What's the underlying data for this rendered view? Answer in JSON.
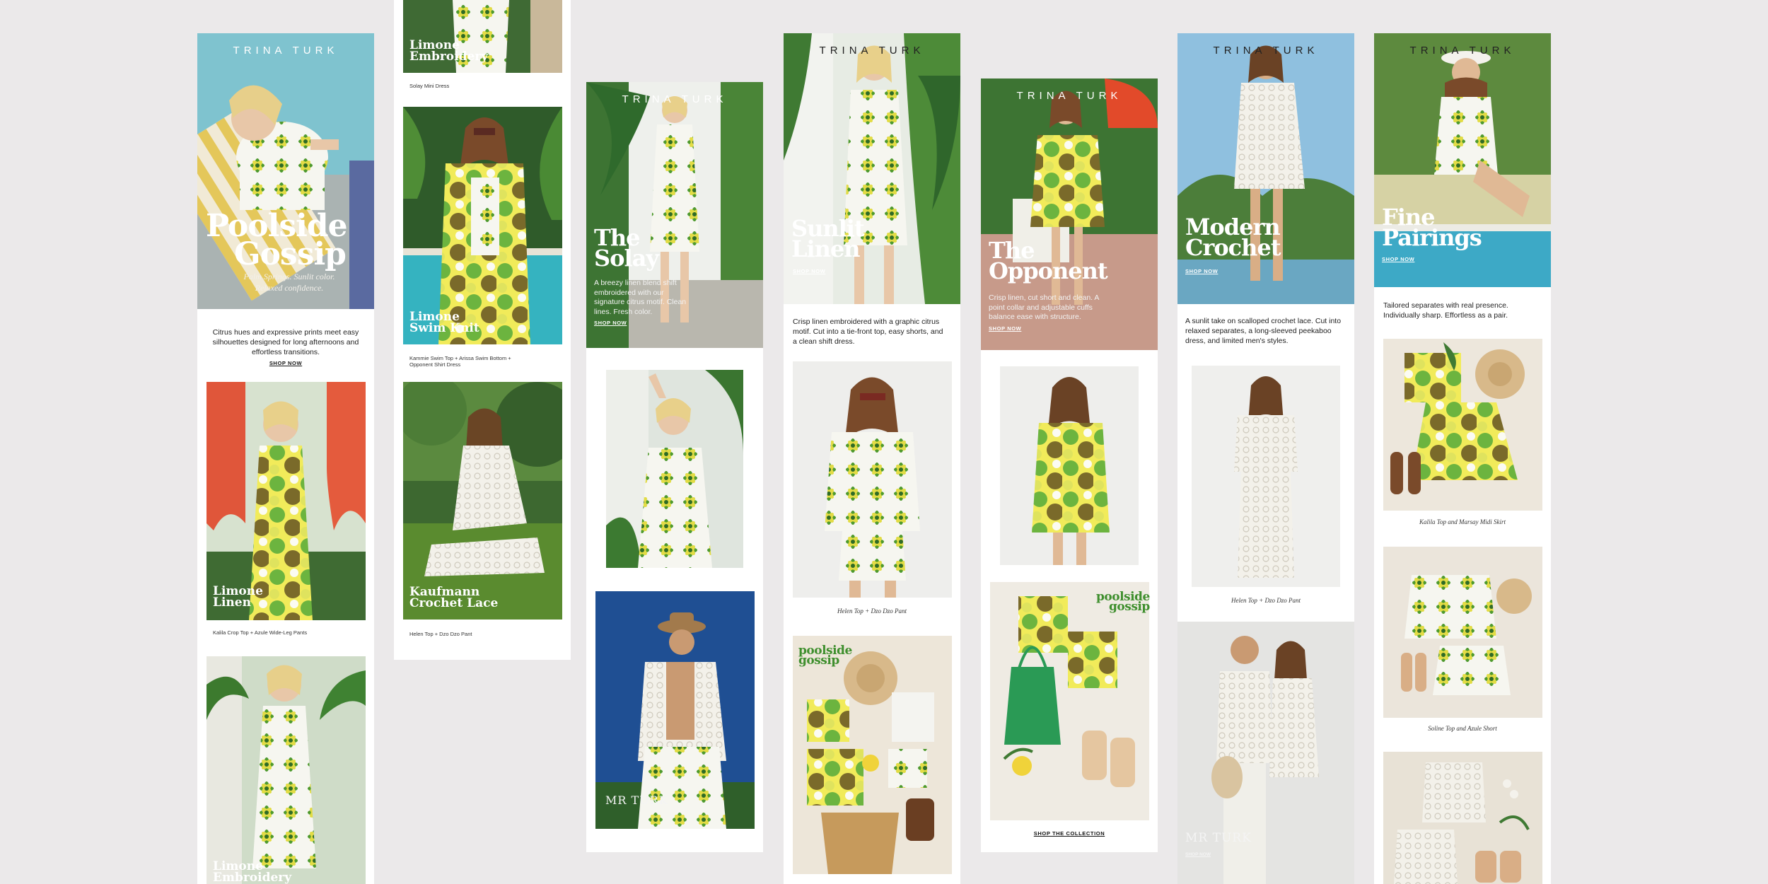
{
  "brand": "TRINA TURK",
  "colors": {
    "background": "#ebe9ea",
    "panel": "#ffffff",
    "print_green": "#5d9e2f",
    "print_yellow": "#e3e25a",
    "print_olive": "#8a7a2c"
  },
  "col1": {
    "headline_line1": "Poolside",
    "headline_line2": "Gossip",
    "tagline_line1": "Palm Springs. Sunlit color.",
    "tagline_line2": "Relaxed confidence.",
    "body": "Citrus hues and expressive prints meet easy silhouettes designed for long afternoons and effortless transitions.",
    "shop": "SHOP NOW",
    "tile1_title_line1": "Limone",
    "tile1_title_line2": "Linen",
    "tile1_caption": "Kalila Crop Top + Azule Wide-Leg Pants",
    "tile2_title_line1": "Limone",
    "tile2_title_line2": "Embroidery"
  },
  "col2": {
    "tile0_title_line1": "Limone",
    "tile0_title_line2": "Embroidery",
    "tile0_caption": "Solay Mini Dress",
    "tile1_title_line1": "Limone",
    "tile1_title_line2": "Swim Knit",
    "tile1_caption": "Kammie Swim Top + Arissa Swim Bottom + Opponent Shirt Dress",
    "tile2_title_line1": "Kaufmann",
    "tile2_title_line2": "Crochet Lace",
    "tile2_caption": "Helen Top + Dzo Dzo Pant"
  },
  "col3": {
    "headline_line1": "The",
    "headline_line2": "Solay",
    "body": "A breezy linen blend shift embroidered with our signature citrus motif. Clean lines. Fresh color.",
    "shop": "SHOP NOW",
    "mr_logo": "MR TURK"
  },
  "col4": {
    "headline_line1": "Sunlit",
    "headline_line2": "Linen",
    "shop": "SHOP NOW",
    "body": "Crisp linen embroidered with a graphic citrus motif. Cut into a tie-front top, easy shorts, and a clean shift dress.",
    "caption1": "Helen Top + Dzo Dzo Pant",
    "flatlay_logo_line1": "poolside",
    "flatlay_logo_line2": "gossip"
  },
  "col5": {
    "headline_line1": "The",
    "headline_line2": "Opponent",
    "body": "Crisp linen, cut short and clean. A point collar and adjustable cuffs balance ease with structure.",
    "shop": "SHOP NOW",
    "flatlay_logo_line1": "poolside",
    "flatlay_logo_line2": "gossip",
    "cta": "SHOP THE COLLECTION"
  },
  "col6": {
    "headline_line1": "Modern",
    "headline_line2": "Crochet",
    "shop": "SHOP NOW",
    "body": "A sunlit take on scalloped crochet lace. Cut into relaxed separates, a long-sleeved peekaboo dress, and limited men's styles.",
    "caption1": "Helen Top + Dzo Dzo Pant",
    "mr_logo": "MR TURK",
    "mr_shop": "SHOP NOW"
  },
  "col7": {
    "headline_line1": "Fine",
    "headline_line2": "Pairings",
    "shop": "SHOP NOW",
    "body": "Tailored separates with real presence. Individually sharp. Effortless as a pair.",
    "caption1": "Kalila Top and Marsay Midi Skirt",
    "caption2": "Soline Top and Azule Short"
  }
}
